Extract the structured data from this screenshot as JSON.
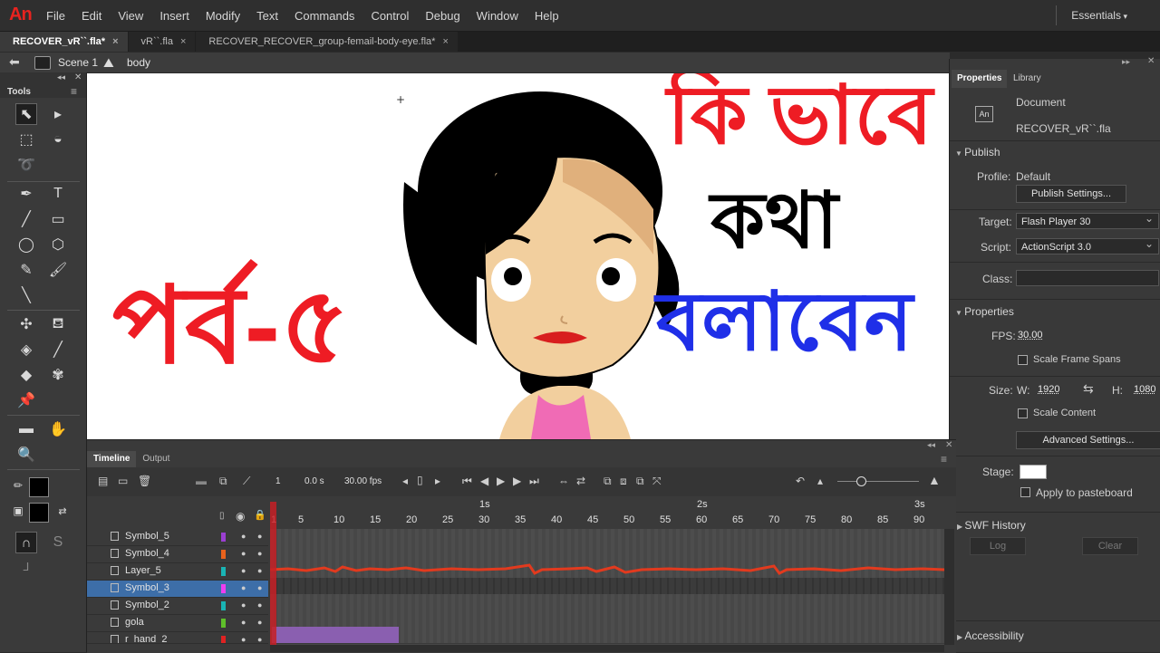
{
  "app": {
    "logo": "An",
    "menus": [
      "File",
      "Edit",
      "View",
      "Insert",
      "Modify",
      "Text",
      "Commands",
      "Control",
      "Debug",
      "Window",
      "Help"
    ],
    "workspace": "Essentials"
  },
  "tabs": [
    {
      "label": "RECOVER_vR``.fla*",
      "close": "×",
      "active": true
    },
    {
      "label": "vR``.fla",
      "close": "×",
      "active": false
    },
    {
      "label": "RECOVER_RECOVER_group-femail-body-eye.fla*",
      "close": "×",
      "active": false
    }
  ],
  "breadcrumb": {
    "scene": "Scene 1",
    "symbol": "body"
  },
  "tools": {
    "title": "Tools"
  },
  "stage": {
    "text_top": "কি ভাবে",
    "text_mid": "কথা",
    "text_bottom": "বলাবেন",
    "text_left": "পর্ব-৫",
    "colors": {
      "red": "#ee1c24",
      "black": "#000000",
      "blue": "#1f2fe8"
    }
  },
  "properties": {
    "tab_properties": "Properties",
    "tab_library": "Library",
    "doc_type": "Document",
    "doc_name": "RECOVER_vR``.fla",
    "publish_header": "Publish",
    "profile_label": "Profile:",
    "profile_value": "Default",
    "publish_settings_btn": "Publish Settings...",
    "target_label": "Target:",
    "target_value": "Flash Player 30",
    "script_label": "Script:",
    "script_value": "ActionScript 3.0",
    "class_label": "Class:",
    "class_value": "",
    "props_header": "Properties",
    "fps_label": "FPS:",
    "fps_value": "30.00",
    "scale_spans": "Scale Frame Spans",
    "size_label": "Size:",
    "w_label": "W:",
    "w_value": "1920",
    "h_label": "H:",
    "h_value": "1080",
    "scale_content": "Scale Content",
    "advanced_btn": "Advanced Settings...",
    "stage_label": "Stage:",
    "stage_color": "#ffffff",
    "apply_paste": "Apply to pasteboard",
    "swf_history": "SWF History",
    "log_btn": "Log",
    "clear_btn": "Clear",
    "accessibility": "Accessibility"
  },
  "timeline": {
    "tab_timeline": "Timeline",
    "tab_output": "Output",
    "frame": "1",
    "time": "0.0 s",
    "fps": "30.00 fps",
    "ticks": [
      "1",
      "5",
      "10",
      "15",
      "20",
      "25",
      "30",
      "35",
      "40",
      "45",
      "50",
      "55",
      "60",
      "65",
      "70",
      "75",
      "80",
      "85",
      "90"
    ],
    "seconds": [
      "1s",
      "2s",
      "3s"
    ],
    "layers": [
      {
        "name": "Symbol_5",
        "color": "#9b3fd1"
      },
      {
        "name": "Symbol_4",
        "color": "#e8621c"
      },
      {
        "name": "Layer_5",
        "color": "#19b4b4"
      },
      {
        "name": "Symbol_3",
        "color": "#ee3df0",
        "selected": true
      },
      {
        "name": "Symbol_2",
        "color": "#19b4b4"
      },
      {
        "name": "gola",
        "color": "#5fbf2a"
      },
      {
        "name": "r_hand_2",
        "color": "#e02222"
      }
    ]
  }
}
